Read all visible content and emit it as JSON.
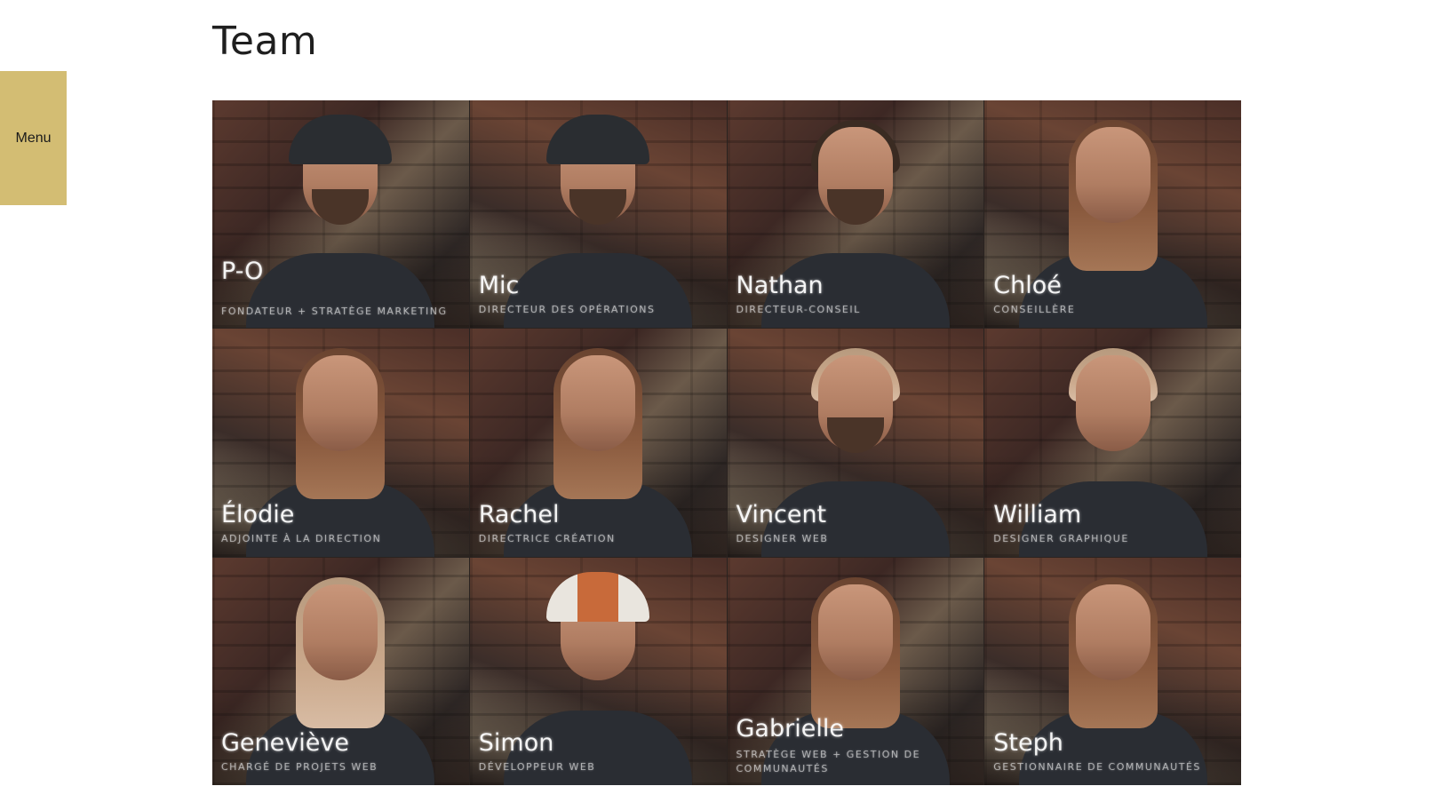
{
  "menu": {
    "label": "Menu"
  },
  "page": {
    "title": "Team"
  },
  "team": [
    {
      "name": "P-O",
      "role": "Fondateur + stratège marketing"
    },
    {
      "name": "Mic",
      "role": "Directeur des opérations"
    },
    {
      "name": "Nathan",
      "role": "Directeur-conseil"
    },
    {
      "name": "Chloé",
      "role": "Conseillère"
    },
    {
      "name": "Élodie",
      "role": "Adjointe à la direction"
    },
    {
      "name": "Rachel",
      "role": "Directrice création"
    },
    {
      "name": "Vincent",
      "role": "Designer web"
    },
    {
      "name": "William",
      "role": "Designer graphique"
    },
    {
      "name": "Geneviève",
      "role": "Chargé de projets web"
    },
    {
      "name": "Simon",
      "role": "Développeur web"
    },
    {
      "name": "Gabrielle",
      "role": "Stratège web + gestion de communautés"
    },
    {
      "name": "Steph",
      "role": "Gestionnaire de communautés"
    }
  ]
}
